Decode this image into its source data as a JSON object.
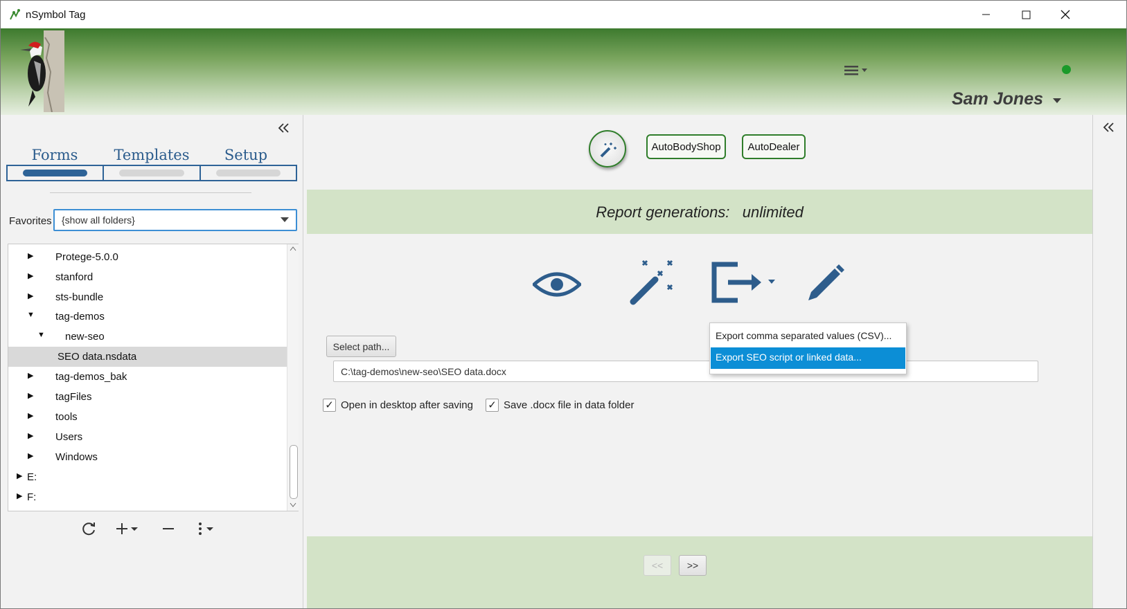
{
  "window": {
    "title": "nSymbol Tag",
    "controls": [
      "minimize",
      "maximize",
      "close"
    ]
  },
  "header": {
    "logo": "woodpecker-logo",
    "menu_icon": "hamburger-menu-icon",
    "user_name": "Sam Jones",
    "status_color": "#1a9a2a"
  },
  "left_panel": {
    "collapse_icon": "double-chevron-left-icon",
    "tabs": [
      {
        "label": "Forms",
        "active": true
      },
      {
        "label": "Templates",
        "active": false
      },
      {
        "label": "Setup",
        "active": false
      }
    ],
    "favorites": {
      "label": "Favorites",
      "selected": "{show all folders}"
    },
    "tree": [
      {
        "label": "Protege-5.0.0",
        "expanded": false
      },
      {
        "label": "stanford",
        "expanded": false
      },
      {
        "label": "sts-bundle",
        "expanded": false
      },
      {
        "label": "tag-demos",
        "expanded": true
      },
      {
        "label": "new-seo",
        "expanded": true
      },
      {
        "label": "SEO data.nsdata",
        "selected": true
      },
      {
        "label": "tag-demos_bak",
        "expanded": false
      },
      {
        "label": "tagFiles",
        "expanded": false
      },
      {
        "label": "tools",
        "expanded": false
      },
      {
        "label": "Users",
        "expanded": false
      },
      {
        "label": "Windows",
        "expanded": false
      },
      {
        "label": "E:",
        "expanded": false
      },
      {
        "label": "F:",
        "expanded": false
      }
    ],
    "toolbar": [
      "refresh-icon",
      "add-icon",
      "remove-icon",
      "more-icon"
    ]
  },
  "main": {
    "wizard_icon": "magic-wand-icon",
    "template_buttons": [
      "AutoBodyShop",
      "AutoDealer"
    ],
    "report_label": "Report generations:",
    "report_value": "unlimited",
    "actions": [
      "eye-icon",
      "magic-wand-icon",
      "export-icon",
      "pencil-icon"
    ],
    "select_path_label": "Select path...",
    "path_value": "C:\\tag-demos\\new-seo\\SEO data.docx",
    "checkboxes": [
      {
        "label": "Open in desktop after saving",
        "checked": true
      },
      {
        "label": "Save .docx file in data folder",
        "checked": true
      }
    ],
    "export_menu": [
      {
        "label": "Export comma separated values (CSV)...",
        "highlighted": false
      },
      {
        "label": "Export SEO script or linked data...",
        "highlighted": true
      }
    ],
    "nav": {
      "prev": "<<",
      "next": ">>"
    }
  },
  "colors": {
    "accent_blue": "#2e6397",
    "green_border": "#2f7d2a",
    "band_green": "#d3e3c7",
    "menu_highlight": "#0c8ed6"
  }
}
